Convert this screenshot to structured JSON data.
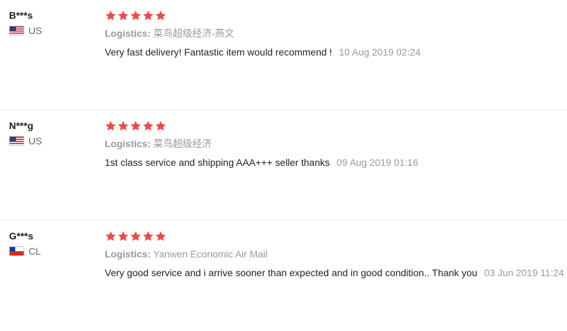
{
  "colors": {
    "star": "#f04848",
    "divider": "#ebebeb",
    "muted": "#999999"
  },
  "reviews": [
    {
      "buyer": "B***s",
      "flag": "us-flag-icon",
      "country": "US",
      "rating": 5,
      "logistics_label": "Logistics:",
      "logistics_value": "菜鸟超级经济-燕文",
      "text": "Very fast delivery! Fantastic item would recommend !",
      "date": "10 Aug 2019 02:24"
    },
    {
      "buyer": "N***g",
      "flag": "us-flag-icon",
      "country": "US",
      "rating": 5,
      "logistics_label": "Logistics:",
      "logistics_value": "菜鸟超级经济",
      "text": "1st class service and shipping AAA+++ seller thanks",
      "date": "09 Aug 2019 01:16"
    },
    {
      "buyer": "G***s",
      "flag": "cl-flag-icon",
      "country": "CL",
      "rating": 5,
      "logistics_label": "Logistics:",
      "logistics_value": "Yanwen Economic Air Mail",
      "text": "Very good service and i arrive sooner than expected and in good condition.. Thank you",
      "date": "03 Jun 2019 11:24"
    }
  ]
}
